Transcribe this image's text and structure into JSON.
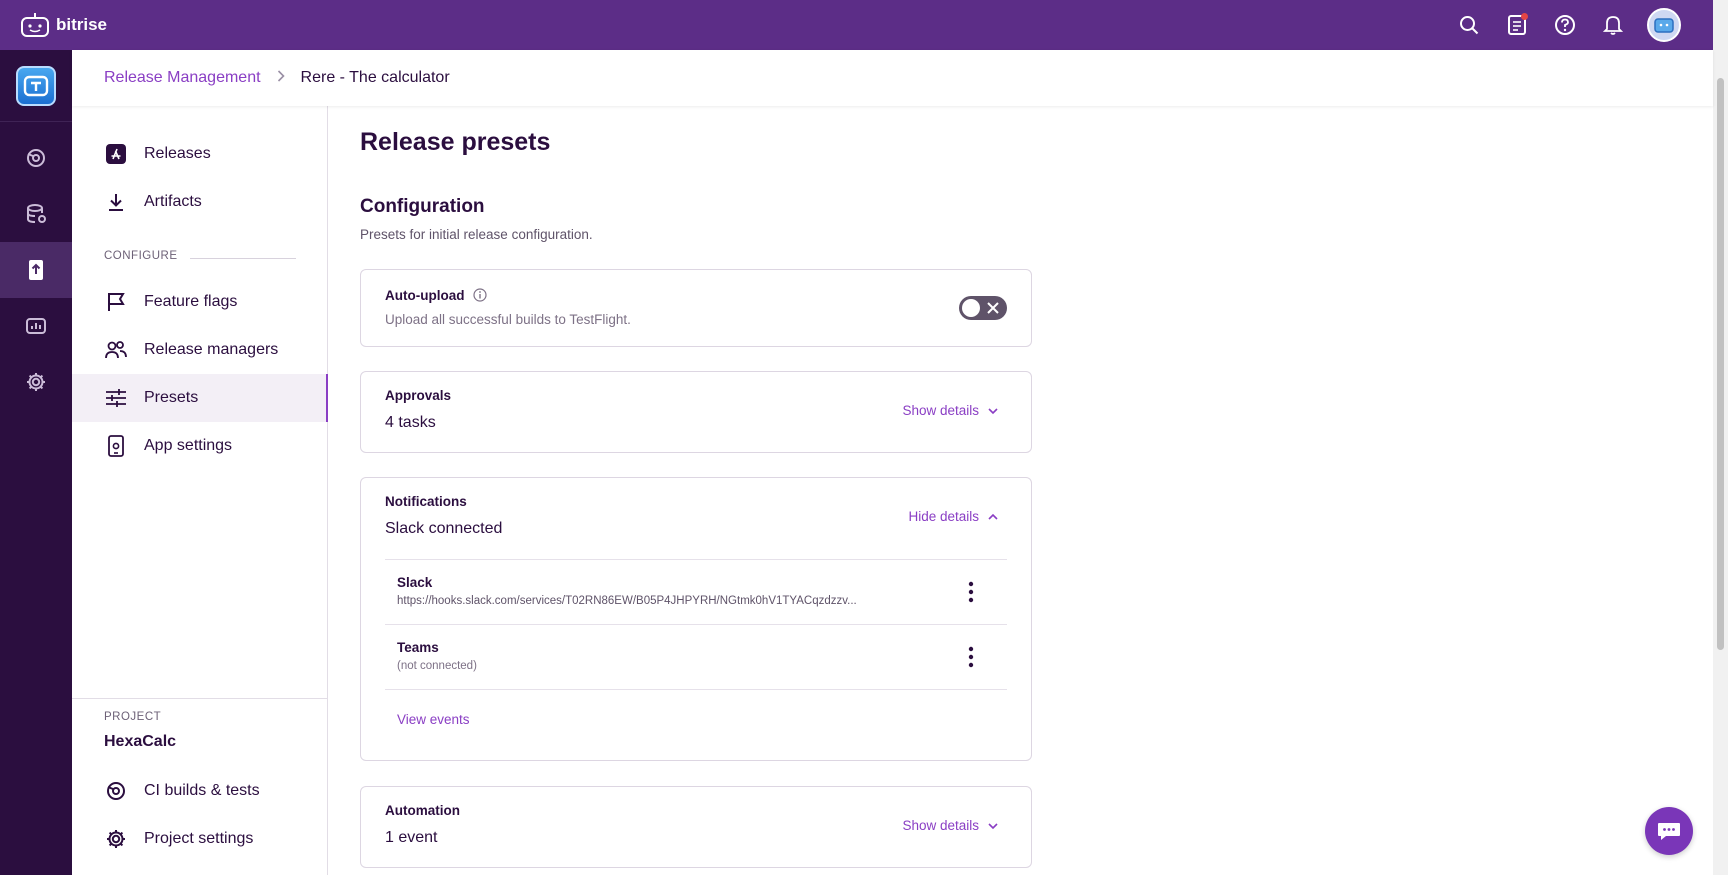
{
  "topbar": {
    "brand": "bitrise",
    "icons": [
      "search-icon",
      "changelog-icon",
      "help-icon",
      "bell-icon",
      "avatar"
    ]
  },
  "breadcrumb": {
    "parent": "Release Management",
    "current": "Rere - The calculator"
  },
  "sidebar": {
    "items_top": [
      {
        "label": "Releases",
        "icon": "app-store-icon"
      },
      {
        "label": "Artifacts",
        "icon": "download-icon"
      }
    ],
    "configure_label": "CONFIGURE",
    "items_configure": [
      {
        "label": "Feature flags",
        "icon": "flag-icon"
      },
      {
        "label": "Release managers",
        "icon": "people-icon"
      },
      {
        "label": "Presets",
        "icon": "sliders-icon",
        "active": true
      },
      {
        "label": "App settings",
        "icon": "phone-settings-icon"
      }
    ],
    "project_label": "PROJECT",
    "project_name": "HexaCalc",
    "items_project": [
      {
        "label": "CI builds & tests",
        "icon": "ci-icon"
      },
      {
        "label": "Project settings",
        "icon": "gear-icon"
      }
    ]
  },
  "main": {
    "title": "Release presets",
    "section_title": "Configuration",
    "section_desc": "Presets for initial release configuration.",
    "auto_upload": {
      "label": "Auto-upload",
      "desc": "Upload all successful builds to TestFlight.",
      "enabled": false
    },
    "approvals": {
      "label": "Approvals",
      "value": "4 tasks",
      "link": "Show details"
    },
    "notifications": {
      "label": "Notifications",
      "value": "Slack connected",
      "link": "Hide details",
      "integrations": [
        {
          "name": "Slack",
          "detail": "https://hooks.slack.com/services/T02RN86EW/B05P4JHPYRH/NGtmk0hV1TYACqzdzzv..."
        },
        {
          "name": "Teams",
          "detail": "(not connected)"
        }
      ],
      "view_events": "View events"
    },
    "automation": {
      "label": "Automation",
      "value": "1 event",
      "link": "Show details"
    }
  },
  "colors": {
    "topbar": "#5c2d87",
    "rail": "#2b0e3f",
    "accent": "#8a3ec4"
  }
}
